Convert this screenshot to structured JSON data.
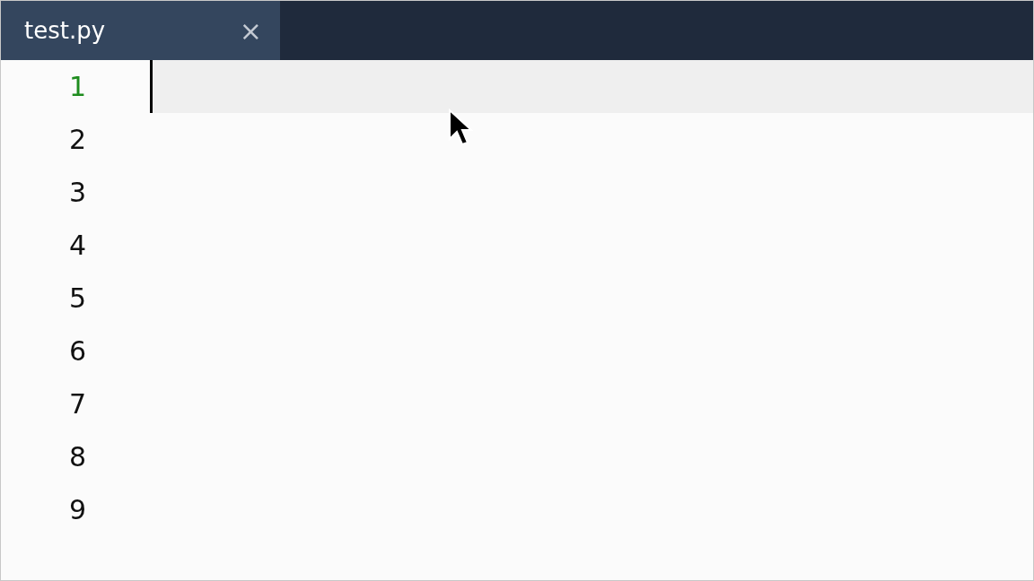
{
  "tabs": [
    {
      "label": "test.py",
      "close": "×",
      "selected": true
    }
  ],
  "editor": {
    "lines": [
      {
        "number": "1",
        "active": true
      },
      {
        "number": "2",
        "active": false
      },
      {
        "number": "3",
        "active": false
      },
      {
        "number": "4",
        "active": false
      },
      {
        "number": "5",
        "active": false
      },
      {
        "number": "6",
        "active": false
      },
      {
        "number": "7",
        "active": false
      },
      {
        "number": "8",
        "active": false
      },
      {
        "number": "9",
        "active": false
      }
    ]
  }
}
